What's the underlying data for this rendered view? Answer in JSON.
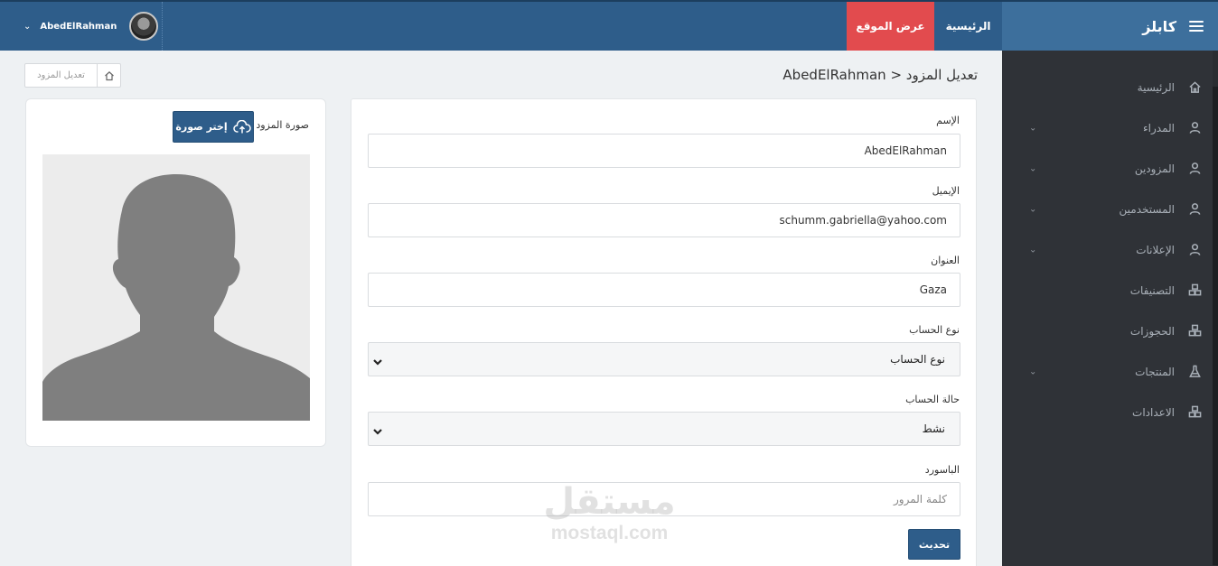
{
  "topbar": {
    "brand": "كابلز",
    "menu_icon": "hamburger-icon",
    "nav_home": "الرئيسية",
    "nav_site": "عرض الموقع",
    "username": "AbedElRahman",
    "accent_color": "#e24b4e",
    "primary_color": "#2e5d8a"
  },
  "sidebar": {
    "items": [
      {
        "label": "الرئيسية",
        "icon": "home-icon",
        "has_submenu": false
      },
      {
        "label": "المدراء",
        "icon": "user-icon",
        "has_submenu": true
      },
      {
        "label": "المزودين",
        "icon": "user-icon",
        "has_submenu": true
      },
      {
        "label": "المستخدمين",
        "icon": "user-icon",
        "has_submenu": true
      },
      {
        "label": "الإعلانات",
        "icon": "user-icon",
        "has_submenu": true
      },
      {
        "label": "التصنيفات",
        "icon": "cubes-icon",
        "has_submenu": false
      },
      {
        "label": "الحجوزات",
        "icon": "cubes-icon",
        "has_submenu": false
      },
      {
        "label": "المنتجات",
        "icon": "flask-icon",
        "has_submenu": true
      },
      {
        "label": "الاعدادات",
        "icon": "cubes-icon",
        "has_submenu": false
      }
    ]
  },
  "header": {
    "title": "تعديل المزود < AbedElRahman",
    "breadcrumb": "تعديل المزود"
  },
  "form": {
    "name_label": "الإسم",
    "name_value": "AbedElRahman",
    "email_label": "الإيميل",
    "email_value": "schumm.gabriella@yahoo.com",
    "address_label": "العنوان",
    "address_value": "Gaza",
    "account_type_label": "نوع الحساب",
    "account_type_value": "نوع الحساب",
    "account_status_label": "حالة الحساب",
    "account_status_value": "نشط",
    "password_label": "الباسورد",
    "password_placeholder": "كلمة المرور",
    "submit_label": "تحديث"
  },
  "image_panel": {
    "label": "صورة المزود",
    "choose_button": "إختر صورة",
    "upload_icon": "cloud-upload-icon"
  },
  "watermark": {
    "arabic": "مستقل",
    "latin": "mostaql.com"
  }
}
